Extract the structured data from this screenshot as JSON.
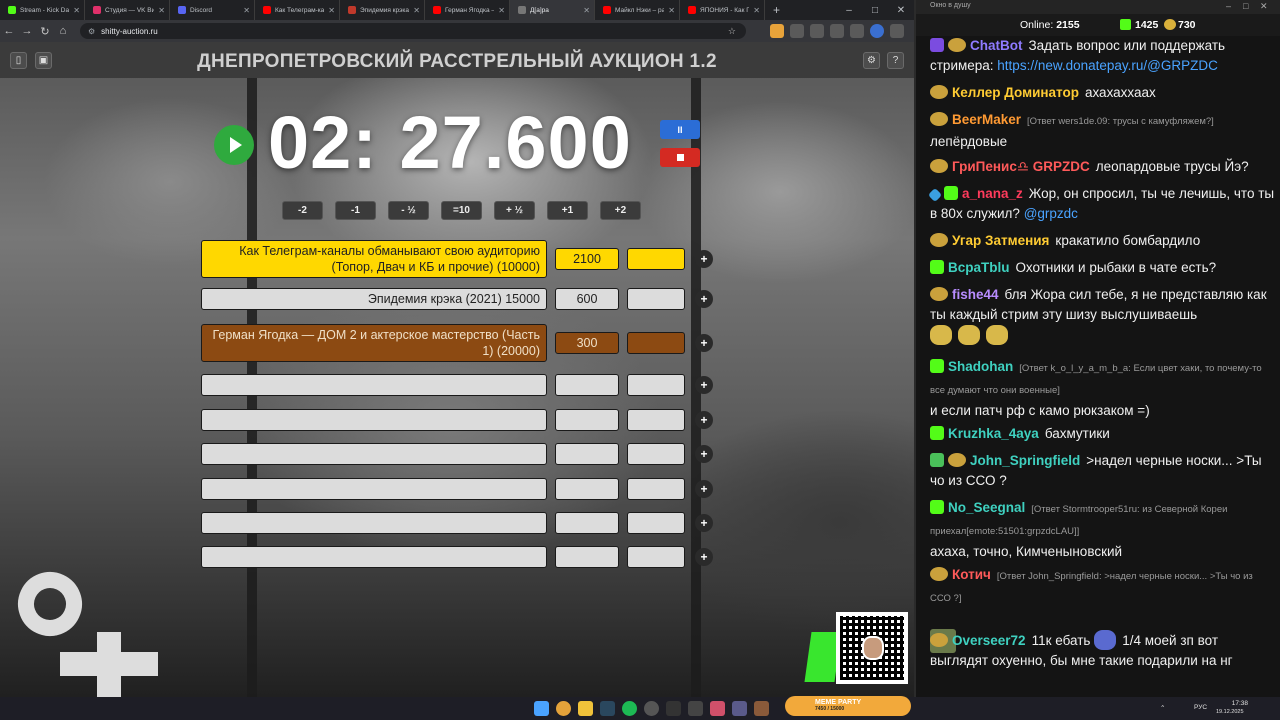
{
  "browser": {
    "tabs": [
      {
        "label": "Stream - Kick Dash",
        "color": "#53fc18",
        "active": false
      },
      {
        "label": "Студия — VK Видео",
        "color": "#e0306a",
        "active": false
      },
      {
        "label": "Discord",
        "color": "#5865f2",
        "active": false
      },
      {
        "label": "Как Телеграм-канал",
        "color": "#ff0000",
        "active": false
      },
      {
        "label": "Эпидемия крэка (",
        "color": "#c0392b",
        "active": false
      },
      {
        "label": "Герман Ягодка —",
        "color": "#ff0000",
        "active": false
      },
      {
        "label": "Д[а]ра",
        "color": "#777777",
        "active": true
      },
      {
        "label": "Майкл Нэки – ра",
        "color": "#ff0000",
        "active": false
      },
      {
        "label": "ЯПОНИЯ - Как По",
        "color": "#ff0000",
        "active": false
      }
    ],
    "tab_add": "+",
    "url": "shitty-auction.ru",
    "controls": {
      "minimize": "–",
      "maximize": "□",
      "close": "✕"
    }
  },
  "auction": {
    "title": "ДНЕПРОПЕТРОВСКИЙ РАССТРЕЛЬНЫЙ АУКЦИОН 1.2",
    "timer": "02: 27.600",
    "pause_label": "II",
    "adjust_buttons": [
      "-2",
      "-1",
      "- ½",
      "=10",
      "+ ½",
      "+1",
      "+2"
    ],
    "lots": [
      {
        "name": "Как Телеграм-каналы обманывают свою аудиторию (Топор, Двач и КБ и прочие) (10000)",
        "amount": "2100",
        "color": "#ffd800",
        "extra_color": "#ffd800"
      },
      {
        "name": "Эпидемия крэка (2021) 15000",
        "amount": "600",
        "color": "#dcdcdc",
        "extra_color": "#dcdcdc"
      },
      {
        "name": "Герман Ягодка — ДОМ 2 и актерское мастерство (Часть 1) (20000)",
        "amount": "300",
        "color": "#8c4a12",
        "extra_color": "#8c4a12"
      },
      {
        "name": "",
        "amount": "",
        "color": "#dcdcdc",
        "extra_color": "#dcdcdc"
      },
      {
        "name": "",
        "amount": "",
        "color": "#dcdcdc",
        "extra_color": "#dcdcdc"
      },
      {
        "name": "",
        "amount": "",
        "color": "#dcdcdc",
        "extra_color": "#dcdcdc"
      },
      {
        "name": "",
        "amount": "",
        "color": "#dcdcdc",
        "extra_color": "#dcdcdc"
      },
      {
        "name": "",
        "amount": "",
        "color": "#dcdcdc",
        "extra_color": "#dcdcdc"
      },
      {
        "name": "",
        "amount": "",
        "color": "#dcdcdc",
        "extra_color": "#dcdcdc"
      }
    ],
    "plus_label": "+"
  },
  "chat": {
    "window_title": "Окно в душу",
    "online_label": "Online:",
    "online_count": "2155",
    "kick_count": "1425",
    "other_count": "730",
    "messages": [
      {
        "badges": [
          "bot",
          "pepe"
        ],
        "nick": "ChatBot",
        "nick_color": "#8f7bff",
        "text": "Задать вопрос или поддержать стримера: ",
        "link": "https://new.donatepay.ru/@GRPZDC"
      },
      {
        "badges": [
          "pepe"
        ],
        "nick": "Келлер Доминатор",
        "nick_color": "#ffcc33",
        "text": "ахахаххаах"
      },
      {
        "badges": [
          "pepe"
        ],
        "nick": "BeerMaker",
        "nick_color": "#ff9a33",
        "reply": "[Ответ wers1de.09: трусы с камуфляжем?]",
        "text": "лепёрдовые"
      },
      {
        "badges": [
          "pepe"
        ],
        "nick": "ГриПенис♎ GRPZDC",
        "nick_color": "#ff5a5a",
        "text": "леопардовые трусы Йэ?"
      },
      {
        "badges": [
          "sword",
          "kick"
        ],
        "nick": "a_nana_z",
        "nick_color": "#ff3b5c",
        "text": "Жор, он спросил, ты че лечишь, что ты в 80х служил? ",
        "mention": "@grpzdc"
      },
      {
        "badges": [
          "pepe"
        ],
        "nick": "Угар Затмения",
        "nick_color": "#ffcc33",
        "text": "кракатило бомбардило"
      },
      {
        "badges": [
          "kick"
        ],
        "nick": "ВсраТblu",
        "nick_color": "#3fd1c0",
        "text": "Охотники и рыбаки в чате есть?"
      },
      {
        "badges": [
          "pepe"
        ],
        "nick": "fishe44",
        "nick_color": "#b88cff",
        "text": "бля Жора сил тебе, я не представляю как ты каждый стрим эту шизу выслушиваешь"
      },
      {
        "badges": [
          "kick"
        ],
        "nick": "Shadohan",
        "nick_color": "#3fd1c0",
        "reply": "[Ответ k_o_l_y_a_m_b_a: Если цвет хаки, то почему-то все думают что они военные]",
        "text": "и если патч рф с камо рюкзаком =)"
      },
      {
        "badges": [
          "kick"
        ],
        "nick": "Kruzhka_4aya",
        "nick_color": "#3fd1c0",
        "text": "бахмутики"
      },
      {
        "badges": [
          "check",
          "pepe"
        ],
        "nick": "John_Springfield",
        "nick_color": "#3fd1c0",
        "text": ">надел черные носки... >Ты чо из ССО ?"
      },
      {
        "badges": [
          "kick"
        ],
        "nick": "No_Seegnal",
        "nick_color": "#3fd1c0",
        "reply": "[Ответ Stormtrooper51ru: из Северной Кореи приехал[emote:51501:grpzdcLAU]]",
        "text": "ахаха, точно, Кимченыновский"
      },
      {
        "badges": [
          "pepe"
        ],
        "nick": "Котич",
        "nick_color": "#ff5a5a",
        "reply": "[Ответ John_Springfield: >надел черные носки... >Ты чо из ССО ?]",
        "text": ""
      },
      {
        "badges": [
          "pepe"
        ],
        "nick": "Overseer72",
        "nick_color": "#3fd1c0",
        "text": "11к ебать",
        "text2": "1/4 моей зп вот выглядят охуенно, бы мне такие подарили на нг"
      }
    ]
  },
  "taskbar": {
    "meme_title": "MEME PARTY",
    "meme_progress": "7450 / 15000",
    "lang": "РУС",
    "time": "17:38",
    "date": "19.12.2025"
  }
}
